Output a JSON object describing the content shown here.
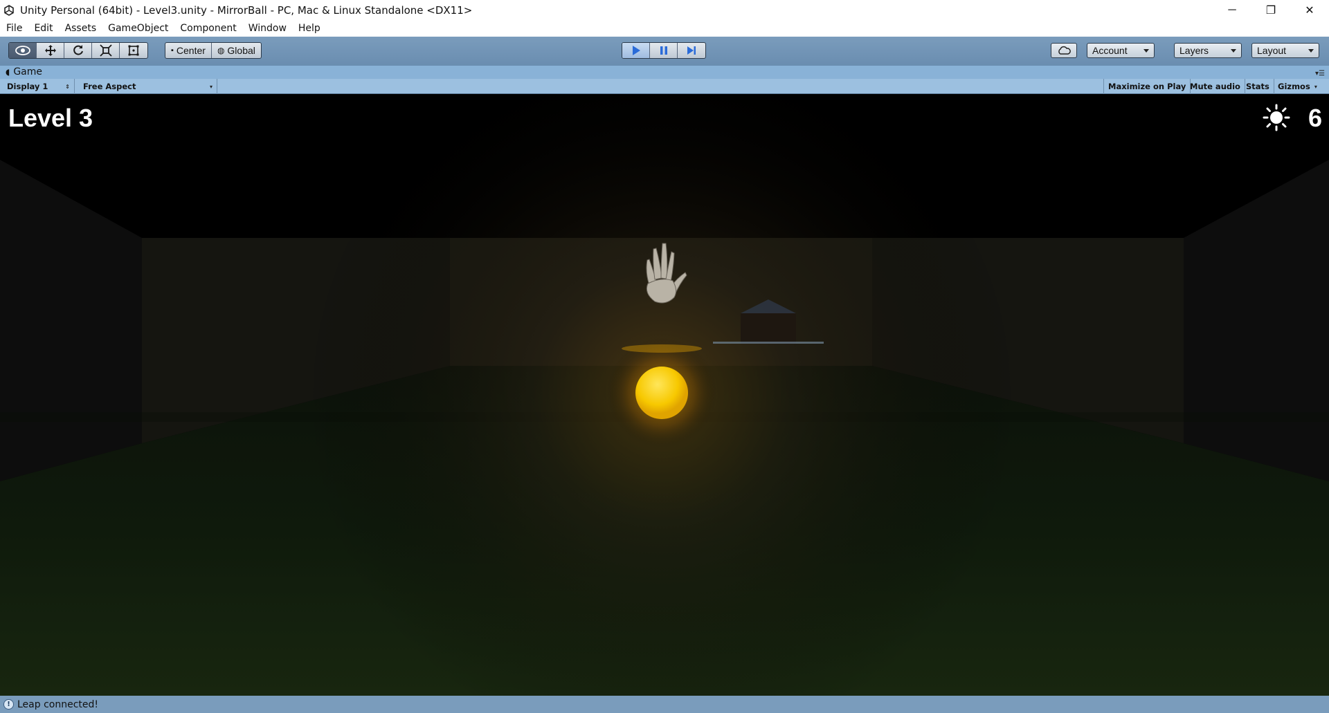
{
  "window": {
    "title": "Unity Personal (64bit) - Level3.unity - MirrorBall - PC, Mac & Linux Standalone <DX11>",
    "controls": {
      "minimize": "─",
      "restore": "❐",
      "close": "✕"
    }
  },
  "menu": {
    "items": [
      "File",
      "Edit",
      "Assets",
      "GameObject",
      "Component",
      "Window",
      "Help"
    ]
  },
  "toolbar": {
    "transform_tools": [
      "view-eye-icon",
      "move-icon",
      "rotate-icon",
      "scale-icon",
      "rect-icon"
    ],
    "pivot_mode": "Center",
    "pivot_rotation": "Global",
    "playback": {
      "play": "play-icon",
      "pause": "pause-icon",
      "step": "step-icon",
      "playing": true
    },
    "cloud_icon": "cloud-icon",
    "account_label": "Account",
    "layers_label": "Layers",
    "layout_label": "Layout"
  },
  "panel": {
    "tab_label": "Game",
    "display": "Display 1",
    "aspect": "Free Aspect",
    "toggles": [
      "Maximize on Play",
      "Mute audio",
      "Stats",
      "Gizmos"
    ]
  },
  "hud": {
    "level_label": "Level 3",
    "sun_icon": "sun-icon",
    "count": "6"
  },
  "status": {
    "icon": "info-icon",
    "message": "Leap connected!"
  },
  "colors": {
    "toolbar": "#6a8db0",
    "panel_tab": "#89b2d7",
    "game_toolbar": "#9cc0e0",
    "ball": "#f5c800",
    "status": "#7a9cbc"
  }
}
